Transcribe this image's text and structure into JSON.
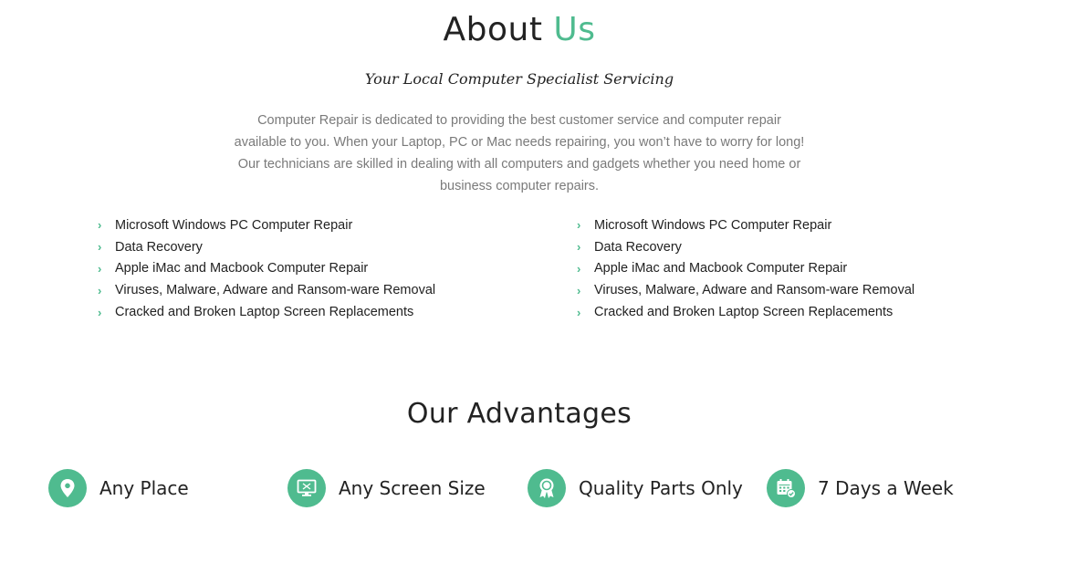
{
  "about": {
    "title_main": "About",
    "title_accent": "Us",
    "subtitle": "Your Local Computer Specialist Servicing",
    "intro_lines": [
      "Computer Repair is dedicated to providing the best customer service and computer repair",
      "available to you. When your Laptop, PC or Mac needs repairing, you won’t have to worry for long!",
      "Our technicians are skilled in dealing with all computers and gadgets whether you need home or",
      "business computer repairs."
    ]
  },
  "services_left": [
    "Microsoft Windows PC Computer Repair",
    "Data Recovery",
    "Apple iMac and Macbook Computer Repair",
    "Viruses, Malware, Adware and Ransom-ware Removal",
    "Cracked and Broken Laptop Screen Replacements"
  ],
  "services_right": [
    "Microsoft Windows PC Computer Repair",
    "Data Recovery",
    "Apple iMac and Macbook Computer Repair",
    "Viruses, Malware, Adware and Ransom-ware Removal",
    "Cracked and Broken Laptop Screen Replacements"
  ],
  "bullet_icon": "chevron-right-icon",
  "advantages": {
    "title": "Our Advantages",
    "items": [
      {
        "label": "Any Place",
        "icon": "location-pin-icon"
      },
      {
        "label": "Any Screen Size",
        "icon": "monitor-icon"
      },
      {
        "label": "Quality Parts Only",
        "icon": "award-ribbon-icon"
      },
      {
        "label": "7 Days a Week",
        "icon": "calendar-check-icon"
      }
    ]
  },
  "colors": {
    "accent": "#4fbb8f",
    "text": "#222222",
    "muted": "#7a7a7a"
  }
}
